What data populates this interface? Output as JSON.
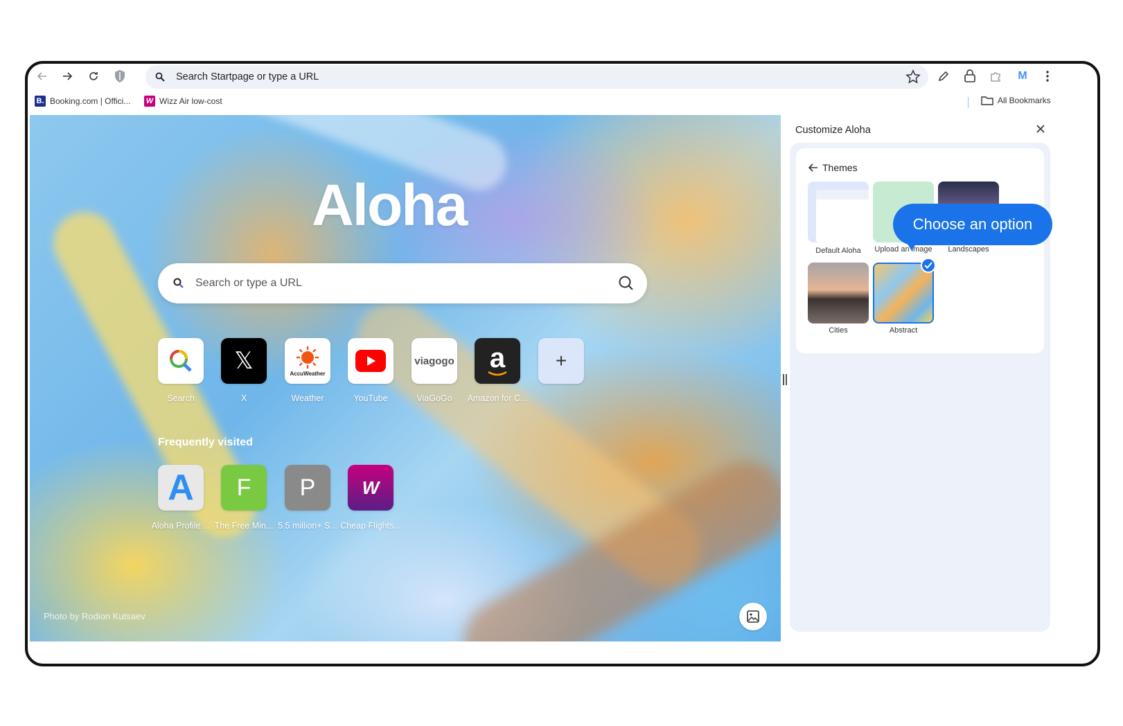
{
  "toolbar": {
    "omnibox_text": "Search Startpage or type a URL",
    "avatar_letter": "M"
  },
  "bookmarks": [
    {
      "label": "Booking.com | Offici...",
      "favicon_text": "B.",
      "favicon_color": "#1b2f8f"
    },
    {
      "label": "Wizz Air low-cost",
      "favicon_text": "W",
      "favicon_color": "#c6007e"
    }
  ],
  "all_bookmarks_label": "All Bookmarks",
  "ntp": {
    "logo": "Aloha",
    "search_placeholder": "Search or type a URL",
    "shortcuts": [
      {
        "label": "Search",
        "icon": "search-magnifier-icon"
      },
      {
        "label": "X",
        "icon": "x-logo-icon",
        "glyph": "𝕏"
      },
      {
        "label": "Weather",
        "icon": "accuweather-icon",
        "glyph": "AccuWeather"
      },
      {
        "label": "YouTube",
        "icon": "youtube-icon"
      },
      {
        "label": "ViaGoGo",
        "icon": "viagogo-icon",
        "glyph": "viagogo"
      },
      {
        "label": "Amazon for C...",
        "icon": "amazon-icon",
        "glyph": "a"
      },
      {
        "label": "",
        "icon": "add-shortcut-icon",
        "glyph": "+"
      }
    ],
    "frequently_visited_title": "Frequently visited",
    "frequent": [
      {
        "label": "Aloha Profile ...",
        "glyph": "A",
        "color": "#e8e8e8"
      },
      {
        "label": "The Free Min...",
        "glyph": "F",
        "color": "#7ac943"
      },
      {
        "label": "5.5 million+ S...",
        "glyph": "P",
        "color": "#8a8a8a"
      },
      {
        "label": "Cheap Flights...",
        "glyph": "W",
        "color": "#c6007e"
      }
    ],
    "photo_credit": "Photo by Rodion Kutsaev"
  },
  "side_panel": {
    "title": "Customize Aloha",
    "section": "Themes",
    "themes": [
      {
        "label": "Default Aloha",
        "selected": false
      },
      {
        "label": "Upload an image",
        "selected": false
      },
      {
        "label": "Landscapes",
        "selected": false
      },
      {
        "label": "Cities",
        "selected": false
      },
      {
        "label": "Abstract",
        "selected": true
      }
    ]
  },
  "tooltip": {
    "text": "Choose an option"
  }
}
